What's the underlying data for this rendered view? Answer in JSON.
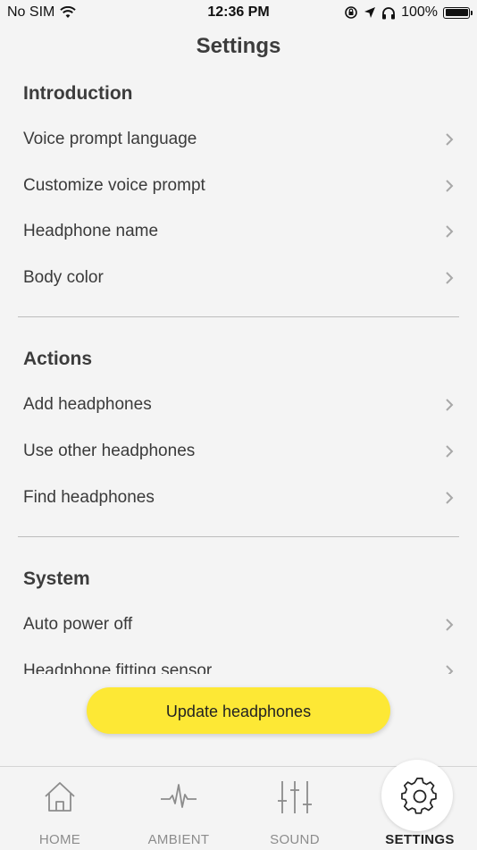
{
  "status": {
    "carrier": "No SIM",
    "time": "12:36 PM",
    "battery": "100%"
  },
  "title": "Settings",
  "sections": [
    {
      "header": "Introduction",
      "items": [
        {
          "label": "Voice prompt language"
        },
        {
          "label": "Customize voice prompt"
        },
        {
          "label": "Headphone name"
        },
        {
          "label": "Body color"
        }
      ]
    },
    {
      "header": "Actions",
      "items": [
        {
          "label": "Add headphones"
        },
        {
          "label": "Use other headphones"
        },
        {
          "label": "Find headphones"
        }
      ]
    },
    {
      "header": "System",
      "items": [
        {
          "label": "Auto power off"
        },
        {
          "label": "Headphone fitting sensor"
        }
      ]
    }
  ],
  "update_button": "Update headphones",
  "tabs": [
    {
      "label": "HOME",
      "icon": "home-icon"
    },
    {
      "label": "AMBIENT",
      "icon": "waveform-icon"
    },
    {
      "label": "SOUND",
      "icon": "equalizer-icon"
    },
    {
      "label": "SETTINGS",
      "icon": "gear-icon",
      "active": true
    }
  ],
  "colors": {
    "accent": "#fde835",
    "background": "#f4f4f4",
    "text": "#3c3c3c"
  }
}
